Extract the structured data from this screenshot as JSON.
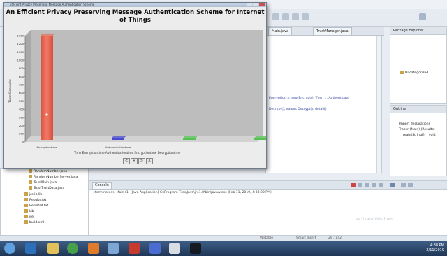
{
  "chart_window": {
    "title_bar": "Efficient Privacy Preserving Message Authentication Scheme",
    "title": "An Efficient Privacy Preserving Message Authentication Scheme for Internet of Things",
    "nav_buttons": [
      "<",
      "+",
      ">",
      "X"
    ]
  },
  "chart_data": {
    "type": "bar",
    "categories": [
      "Encryptiontime",
      "Authenticationtime",
      "Encryptiontime",
      "Decryptiontime"
    ],
    "values": [
      1275,
      25,
      20,
      20
    ],
    "bar_colors": [
      "#e8735e",
      "#4a4ad0",
      "#55c255",
      "#55c255"
    ],
    "ylabel": "Time(Seconds)",
    "ylim": [
      0,
      1300
    ],
    "yticks": [
      "1300",
      "1200",
      "1100",
      "1000",
      "900",
      "800",
      "700",
      "600",
      "500",
      "400",
      "300",
      "200",
      "100",
      "0"
    ],
    "legend": "Time      Encryptiontime Authenticationtime Encryptiontime Decryptiontime",
    "grid": false
  },
  "ide": {
    "editor_tabs": [
      "Main.java",
      "TrustManager.java"
    ],
    "code_lines": [
      "Encryption = new Encrypt(); Then ... Authenticate",
      "Decrypt(); values Decrypt(): detail()"
    ],
    "package_panel_title": "Package Explorer",
    "package_item": "Uncategorized",
    "outline_title": "Outline",
    "outline_items": [
      "Import declarations",
      "Tracer (Main) (Results)",
      "main(String[]) : void"
    ],
    "tree_items": [
      "RandomNumber.java",
      "RandomNumberServer.java",
      "TrustMain.java",
      "TrustTrustData.java",
      "jrelib.lib",
      "Results.txt",
      "Results4.txt",
      "Lib",
      "jre",
      "build.xml"
    ],
    "console_tab": "Console",
    "console_line": "<terminated> Main (1) [Java Application] C:\\Program Files\\Java\\jre1.8\\bin\\javaw.exe (Feb 11, 2019, 4:38:00 PM)",
    "watermark": "Activate Windows",
    "status": [
      "Writable",
      "Smart Insert",
      "29 : 142"
    ]
  },
  "taskbar": {
    "time": "4:38 PM",
    "date": "2/11/2019"
  }
}
